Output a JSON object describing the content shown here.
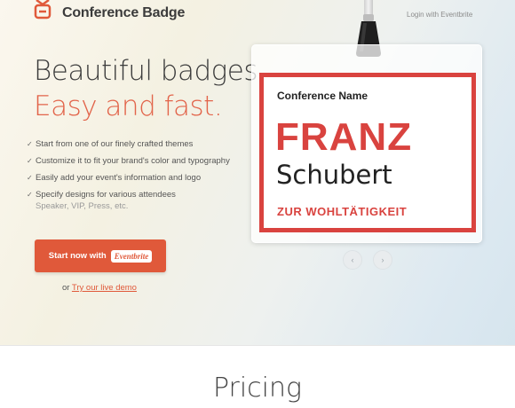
{
  "header": {
    "logo_text": "Conference Badge",
    "login_link": "Login with Eventbrite",
    "logo_icon": "badge-logo-icon"
  },
  "hero": {
    "headline_line1": "Beautiful badges.",
    "headline_line2": "Easy and fast.",
    "features": [
      {
        "text": "Start from one of our finely crafted themes"
      },
      {
        "text": "Customize it to fit your brand's color and typography"
      },
      {
        "text": "Easily add your event's information and logo"
      },
      {
        "text": "Specify designs for various attendees",
        "sub": "Speaker, VIP, Press, etc."
      }
    ],
    "check_glyph": "✓",
    "cta": {
      "label": "Start now with",
      "badge": "Eventbrite"
    },
    "demo": {
      "prefix": "or",
      "link": "Try our live demo"
    }
  },
  "badge": {
    "conference_name": "Conference Name",
    "first_name": "FRANZ",
    "last_name": "Schubert",
    "extra": "ZUR WOHLTÄTIGKEIT",
    "accent_color": "#d9433f"
  },
  "carousel": {
    "prev_icon": "‹",
    "next_icon": "›"
  },
  "pricing": {
    "title": "Pricing"
  },
  "colors": {
    "brand": "#e0593a",
    "text_dark": "#3c3c3c"
  }
}
